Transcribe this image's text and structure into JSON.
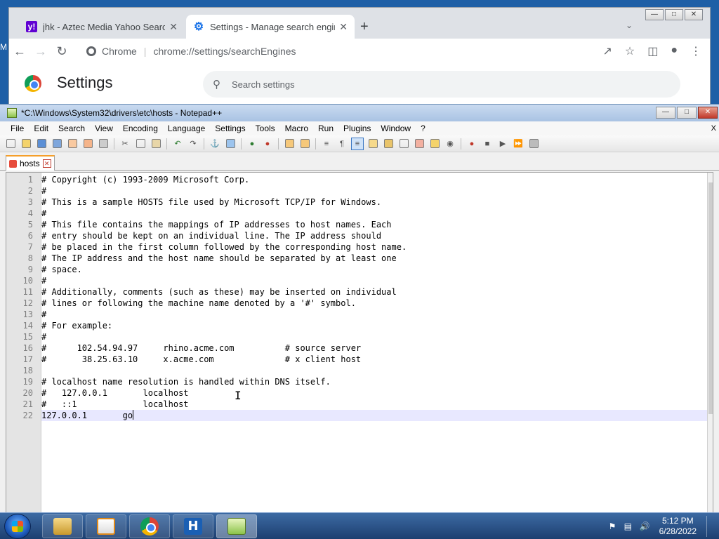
{
  "chrome": {
    "tabs": [
      {
        "title": "jhk - Aztec Media Yahoo Search R",
        "favicon": "yahoo-icon",
        "close": "✕"
      },
      {
        "title": "Settings - Manage search engine",
        "favicon": "gear-icon",
        "close": "✕"
      }
    ],
    "new_tab": "+",
    "tab_search": "⌄",
    "omnibox_label": "Chrome",
    "url": "chrome://settings/searchEngines",
    "settings_title": "Settings",
    "search_placeholder": "Search settings"
  },
  "left_edge_text": "M",
  "notepad": {
    "title": "*C:\\Windows\\System32\\drivers\\etc\\hosts - Notepad++",
    "menu": [
      "File",
      "Edit",
      "Search",
      "View",
      "Encoding",
      "Language",
      "Settings",
      "Tools",
      "Macro",
      "Run",
      "Plugins",
      "Window",
      "?"
    ],
    "menu_close": "X",
    "tab_name": "hosts",
    "line_numbers": [
      "1",
      "2",
      "3",
      "4",
      "5",
      "6",
      "7",
      "8",
      "9",
      "10",
      "11",
      "12",
      "13",
      "14",
      "15",
      "16",
      "17",
      "18",
      "19",
      "20",
      "21",
      "22"
    ],
    "lines": [
      "# Copyright (c) 1993-2009 Microsoft Corp.",
      "#",
      "# This is a sample HOSTS file used by Microsoft TCP/IP for Windows.",
      "#",
      "# This file contains the mappings of IP addresses to host names. Each",
      "# entry should be kept on an individual line. The IP address should",
      "# be placed in the first column followed by the corresponding host name.",
      "# The IP address and the host name should be separated by at least one",
      "# space.",
      "#",
      "# Additionally, comments (such as these) may be inserted on individual",
      "# lines or following the machine name denoted by a '#' symbol.",
      "#",
      "# For example:",
      "#",
      "#      102.54.94.97     rhino.acme.com          # source server",
      "#       38.25.63.10     x.acme.com              # x client host",
      "",
      "# localhost name resolution is handled within DNS itself.",
      "#   127.0.0.1       localhost",
      "#   ::1             localhost",
      "127.0.0.1       go"
    ]
  },
  "taskbar": {
    "time": "5:12 PM",
    "date": "6/28/2022"
  }
}
